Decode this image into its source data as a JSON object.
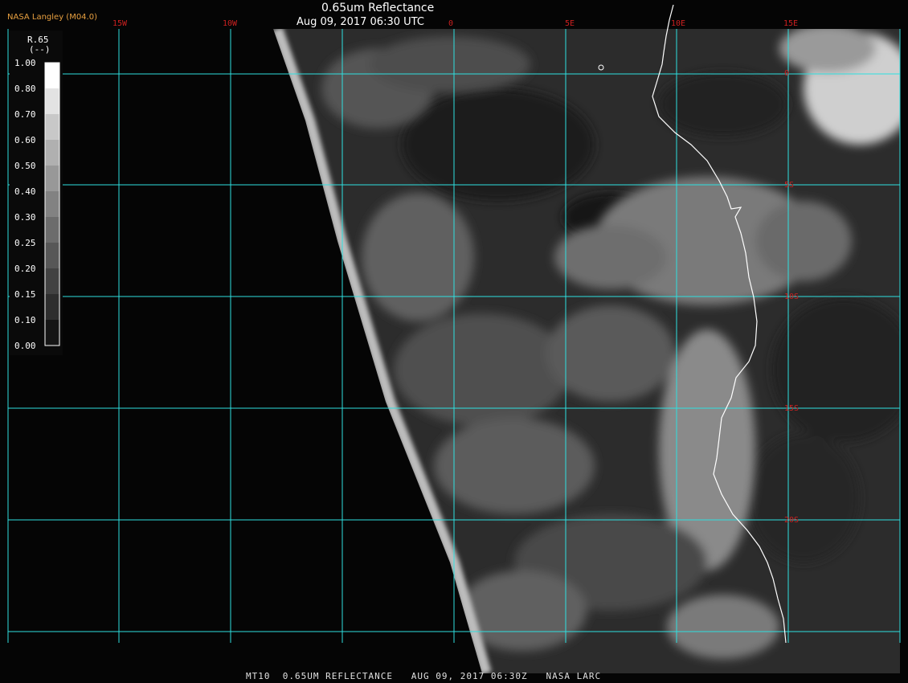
{
  "header": {
    "brand": "NASA Langley (M04.0)",
    "title": "0.65um Reflectance",
    "datetime": "Aug 09, 2017 06:30 UTC"
  },
  "map": {
    "lon_labels": [
      "15W",
      "10W",
      "0",
      "5E",
      "10E",
      "15E"
    ],
    "lat_labels": [
      "0",
      "5S",
      "10S",
      "15S",
      "20S"
    ],
    "grid_color": "#2ee0e0",
    "coast_color": "#ffffff",
    "label_color": "#cc2020"
  },
  "colorbar": {
    "title": "R.65",
    "unit": "(--)",
    "ticks": [
      "1.00",
      "0.80",
      "0.70",
      "0.60",
      "0.50",
      "0.40",
      "0.30",
      "0.25",
      "0.20",
      "0.15",
      "0.10",
      "0.00"
    ]
  },
  "footer": {
    "text": "MT10  0.65UM REFLECTANCE   AUG 09, 2017 06:30Z   NASA LARC"
  }
}
